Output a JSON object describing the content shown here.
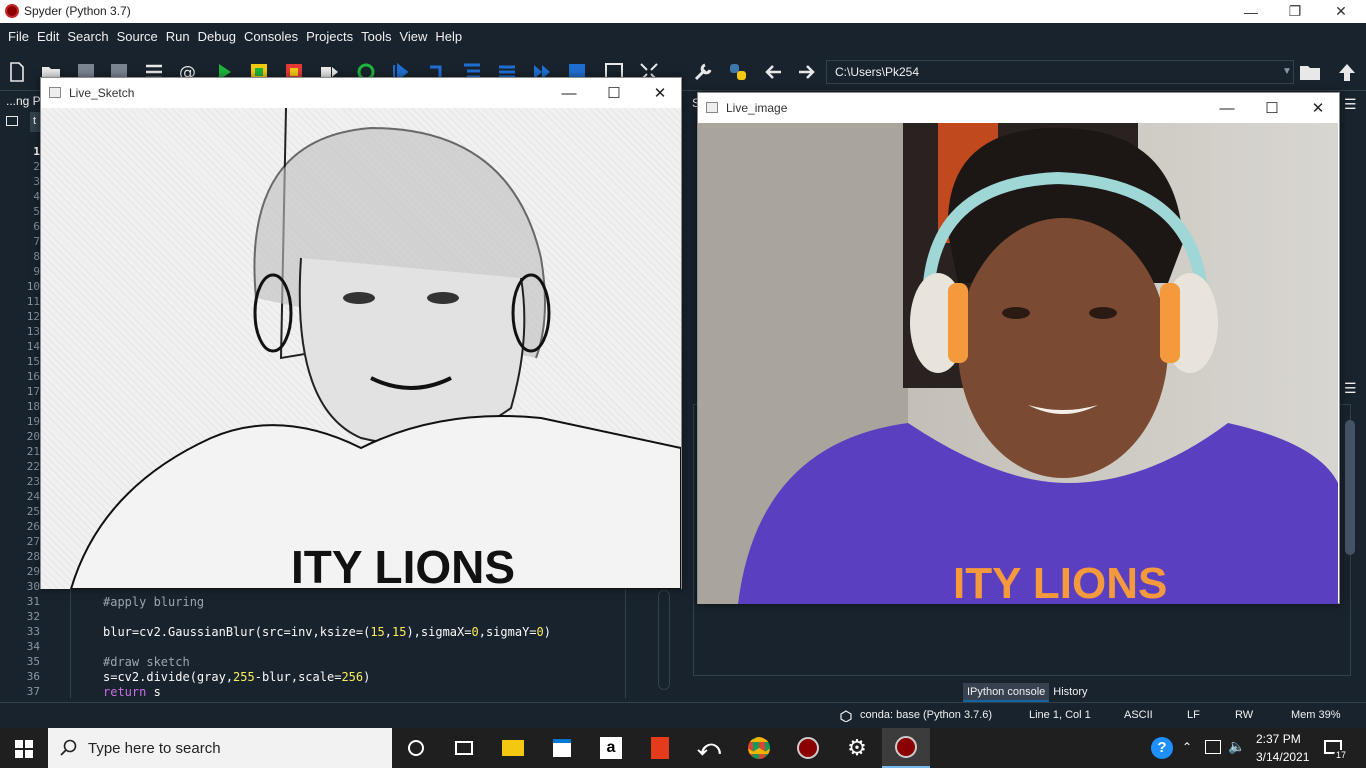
{
  "window": {
    "title": "Spyder (Python 3.7)"
  },
  "menu": [
    "File",
    "Edit",
    "Search",
    "Source",
    "Run",
    "Debug",
    "Consoles",
    "Projects",
    "Tools",
    "View",
    "Help"
  ],
  "toolbar": {
    "working_dir": "C:\\Users\\Pk254"
  },
  "editor": {
    "partial_label": "...ng P",
    "line_numbers": [
      "1",
      "2",
      "3",
      "4",
      "5",
      "6",
      "7",
      "8",
      "9",
      "10",
      "11",
      "12",
      "13",
      "14",
      "15",
      "16",
      "17",
      "18",
      "19",
      "20",
      "21",
      "22",
      "23",
      "24",
      "25",
      "26",
      "27",
      "28",
      "29",
      "30",
      "31",
      "32",
      "33",
      "34",
      "35",
      "36",
      "37"
    ],
    "code": {
      "l31": "#apply bluring",
      "l33_pre": "blur=cv2.GaussianBlur(src=inv,ksize=(",
      "l33_n1": "15",
      "l33_mid": ",",
      "l33_n2": "15",
      "l33_mid2": "),sigmaX=",
      "l33_n3": "0",
      "l33_mid3": ",sigmaY=",
      "l33_n4": "0",
      "l33_end": ")",
      "l35": "#draw sketch",
      "l36_pre": "s=cv2.divide(gray,",
      "l36_n1": "255",
      "l36_mid": "-blur,scale=",
      "l36_n2": "256",
      "l36_end": ")",
      "l37_kw": "return",
      "l37_rest": " s"
    }
  },
  "right_pane": {
    "partial_label": "S"
  },
  "console_tabs": {
    "ipython": "IPython console",
    "history": "History"
  },
  "status": {
    "conda": "conda: base (Python 3.7.6)",
    "cursor": "Line 1, Col 1",
    "encoding": "ASCII",
    "eol": "LF",
    "perm": "RW",
    "mem": "Mem 39%"
  },
  "windows": {
    "sketch": {
      "title": "Live_Sketch",
      "shirt_text": "ITY LIONS"
    },
    "camera": {
      "title": "Live_image",
      "shirt_text": "ITY LIONS"
    }
  },
  "taskbar": {
    "search_placeholder": "Type here to search",
    "time": "2:37 PM",
    "date": "3/14/2021",
    "notification_count": "17"
  },
  "colors": {
    "spyder_bg": "#19232d",
    "accent": "#1464a0",
    "shirt_purple": "#5a3fc0"
  }
}
